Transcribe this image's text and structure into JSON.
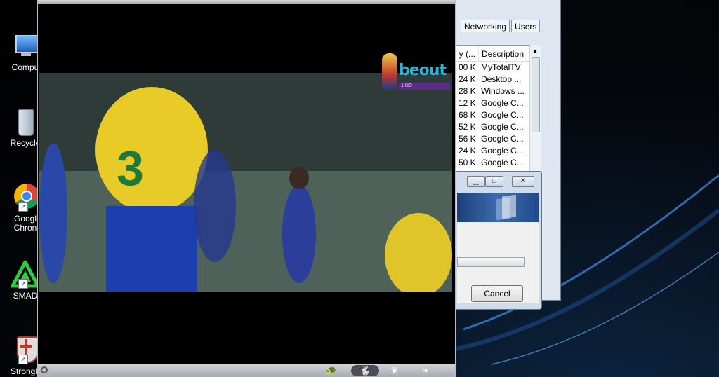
{
  "desktop": {
    "icons": [
      {
        "label": "Compu",
        "icon": "computer-icon"
      },
      {
        "label": "Recycle",
        "icon": "recycle-bin-icon"
      },
      {
        "label": "Googl",
        "label2": "Chron",
        "icon": "chrome-icon"
      },
      {
        "label": "SMAD",
        "icon": "smadav-icon"
      },
      {
        "label": "Strongh",
        "icon": "stronghold-icon"
      }
    ]
  },
  "task_manager": {
    "tabs": [
      "Networking",
      "Users"
    ],
    "columns": [
      "y (...",
      "Description"
    ],
    "rows": [
      {
        "mem": "00 K",
        "desc": "MyTotalTV"
      },
      {
        "mem": "24 K",
        "desc": "Desktop ..."
      },
      {
        "mem": "28 K",
        "desc": "Windows ..."
      },
      {
        "mem": "12 K",
        "desc": "Google C..."
      },
      {
        "mem": "68 K",
        "desc": "Google C..."
      },
      {
        "mem": "52 K",
        "desc": "Google C..."
      },
      {
        "mem": "56 K",
        "desc": "Google C..."
      },
      {
        "mem": "24 K",
        "desc": "Google C..."
      },
      {
        "mem": "50 K",
        "desc": "Google C..."
      }
    ]
  },
  "dialog": {
    "cancel_label": "Cancel",
    "minimize_glyph": "▁",
    "maximize_glyph": "□",
    "close_glyph": "✕"
  },
  "player": {
    "channel_logo": "beout",
    "channel_sub": "1 HD",
    "controls": [
      {
        "icon": "turtle-icon",
        "glyph": "🐢"
      },
      {
        "icon": "speed-icon",
        "glyph": "🐇"
      },
      {
        "icon": "ostrich-icon",
        "glyph": "❦"
      },
      {
        "icon": "bird-icon",
        "glyph": "❧"
      }
    ]
  }
}
